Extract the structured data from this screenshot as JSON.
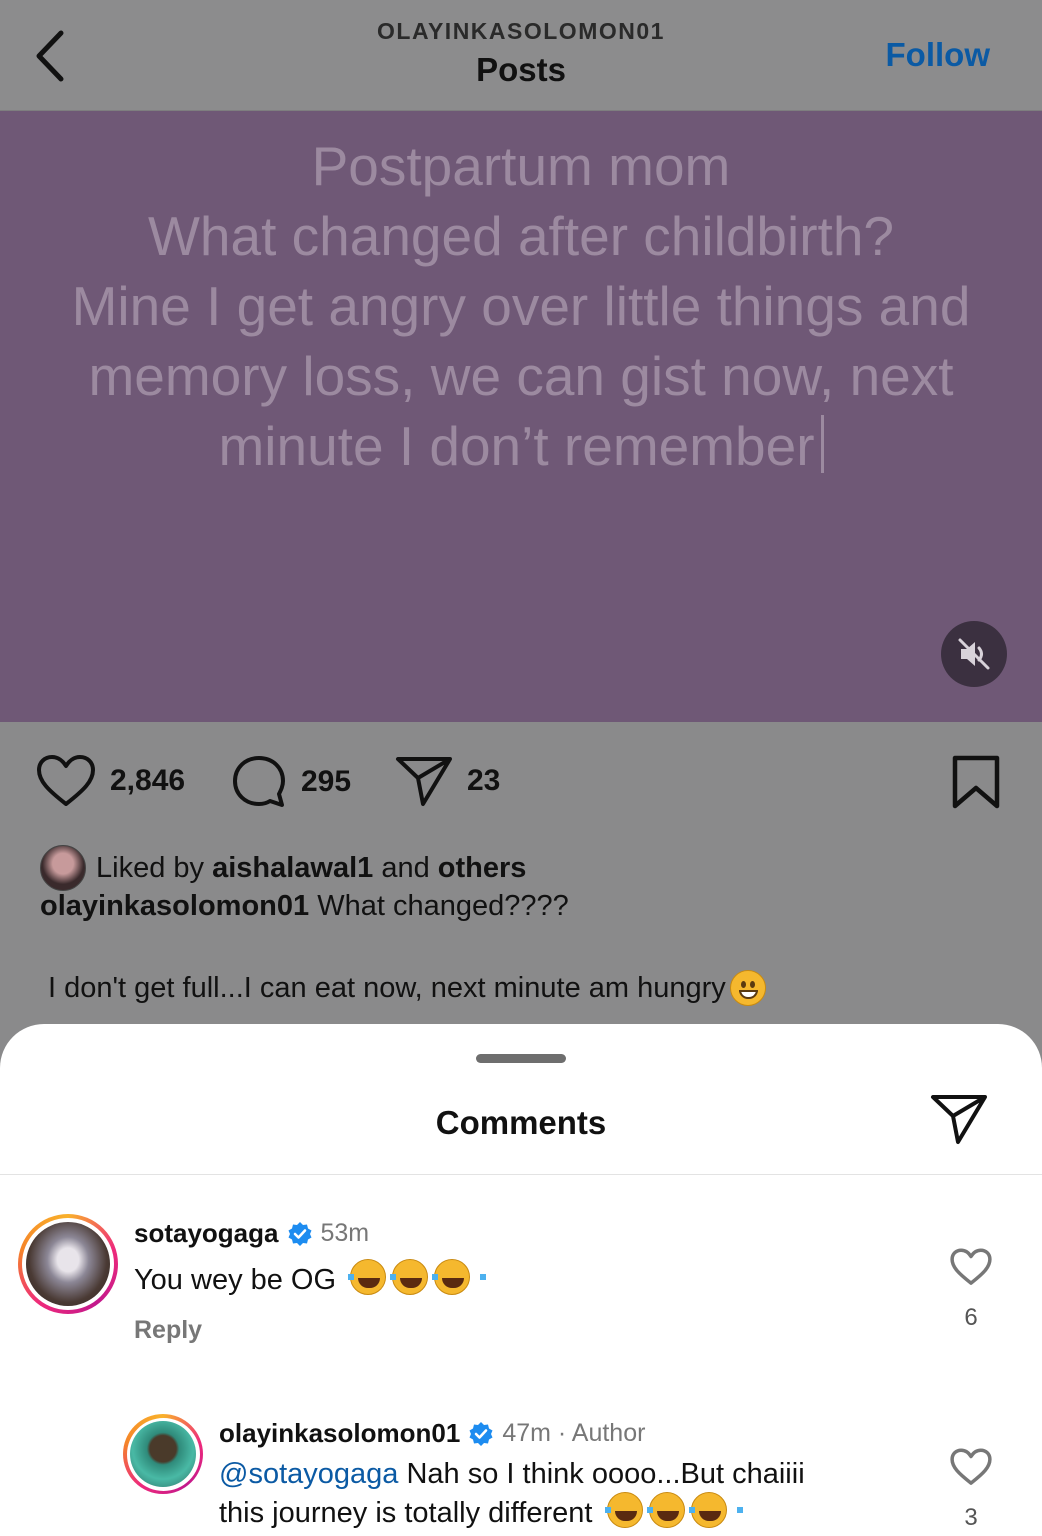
{
  "header": {
    "username": "OLAYINKASOLOMON01",
    "title": "Posts",
    "follow_label": "Follow"
  },
  "media": {
    "lines": [
      "Postpartum mom",
      "What changed after childbirth?",
      "Mine I get angry over little things and",
      "memory loss, we can gist now, next",
      "minute I don’t remember"
    ],
    "background": "#6f5876",
    "muted": true
  },
  "actions": {
    "likes": "2,846",
    "comments": "295",
    "shares": "23"
  },
  "liked_by": {
    "prefix": "Liked by ",
    "user": "aishalawal1",
    "middle": " and ",
    "others": "others"
  },
  "caption": {
    "user": "olayinkasolomon01",
    "text": " What changed????",
    "line2": "I don't get full...I can eat now, next minute am hungry"
  },
  "comments_sheet": {
    "title": "Comments",
    "items": [
      {
        "user": "sotayogaga",
        "verified": true,
        "time": "53m",
        "text": "You wey be OG",
        "reply_label": "Reply",
        "likes": "6"
      },
      {
        "user": "olayinkasolomon01",
        "verified": true,
        "time": "47m · Author",
        "mention": "@sotayogaga",
        "text_line1": " Nah so I think oooo...But chaiiii",
        "text_line2": "this journey is totally different",
        "likes": "3"
      }
    ]
  },
  "colors": {
    "accent": "#0b5aa4",
    "verified": "#1d8cf0"
  }
}
